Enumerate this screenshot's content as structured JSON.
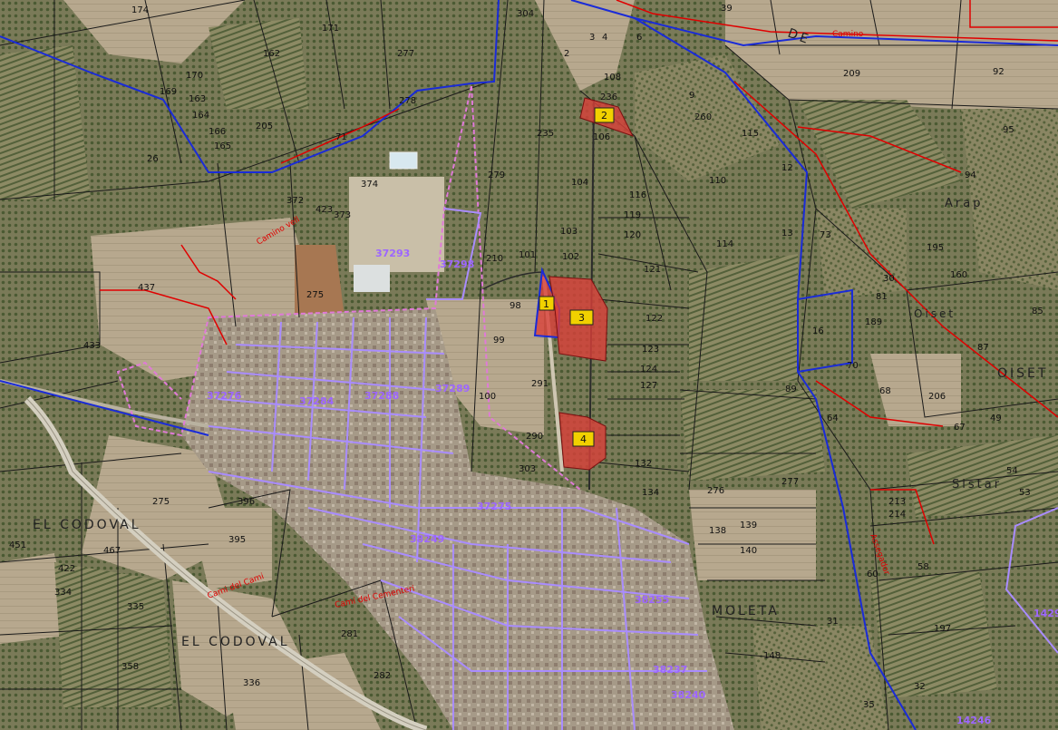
{
  "map": {
    "colors": {
      "orchard": "#6f7550",
      "field": "#b6a890",
      "urban": "#a89e8e",
      "highlight_fill": "#d9403a",
      "boundary_blue": "#1a2bd8",
      "urban_boundary": "#a98cff",
      "road_red": "#e00000"
    },
    "place_labels": [
      "EL CODOVAL",
      "EL CODOVAL",
      "MOLETA",
      "OISET",
      "Arap",
      "Oiset",
      "Sistar",
      "DE"
    ],
    "markers": [
      {
        "label": "1"
      },
      {
        "label": "2"
      },
      {
        "label": "3"
      },
      {
        "label": "4"
      }
    ],
    "block_labels": [
      "37293",
      "37289",
      "37298",
      "37284",
      "37275",
      "37288",
      "37276",
      "38255",
      "38249",
      "38237",
      "14297",
      "14246",
      "38240"
    ],
    "road_labels": [
      "Camino",
      "Camí del Cementeri",
      "Assegador",
      "Cami del Cami",
      "Camino vell"
    ],
    "parcel_labels": [
      "174",
      "171",
      "304",
      "39",
      "170",
      "162",
      "277",
      "278",
      "2",
      "209",
      "92",
      "169",
      "163",
      "164",
      "236",
      "108",
      "165",
      "166",
      "26",
      "205",
      "71",
      "235",
      "106",
      "260",
      "95",
      "374",
      "372",
      "279",
      "104",
      "110",
      "94",
      "423",
      "373",
      "116",
      "119",
      "120",
      "114",
      "73",
      "195",
      "437",
      "275",
      "210",
      "101",
      "121",
      "103",
      "102",
      "160",
      "30",
      "81",
      "189",
      "85",
      "433",
      "98",
      "123",
      "122",
      "87",
      "99",
      "100",
      "291",
      "124",
      "127",
      "70",
      "68",
      "206",
      "64",
      "67",
      "49",
      "275",
      "290",
      "303",
      "132",
      "134",
      "277",
      "54",
      "53",
      "396",
      "395",
      "276",
      "138",
      "139",
      "213",
      "214",
      "451",
      "467",
      "422",
      "334",
      "335",
      "358",
      "336",
      "281",
      "282",
      "140",
      "148",
      "197",
      "32",
      "35",
      "58",
      "60",
      "31",
      "9",
      "12",
      "13",
      "16",
      "89",
      "3",
      "4",
      "6",
      "115"
    ]
  }
}
